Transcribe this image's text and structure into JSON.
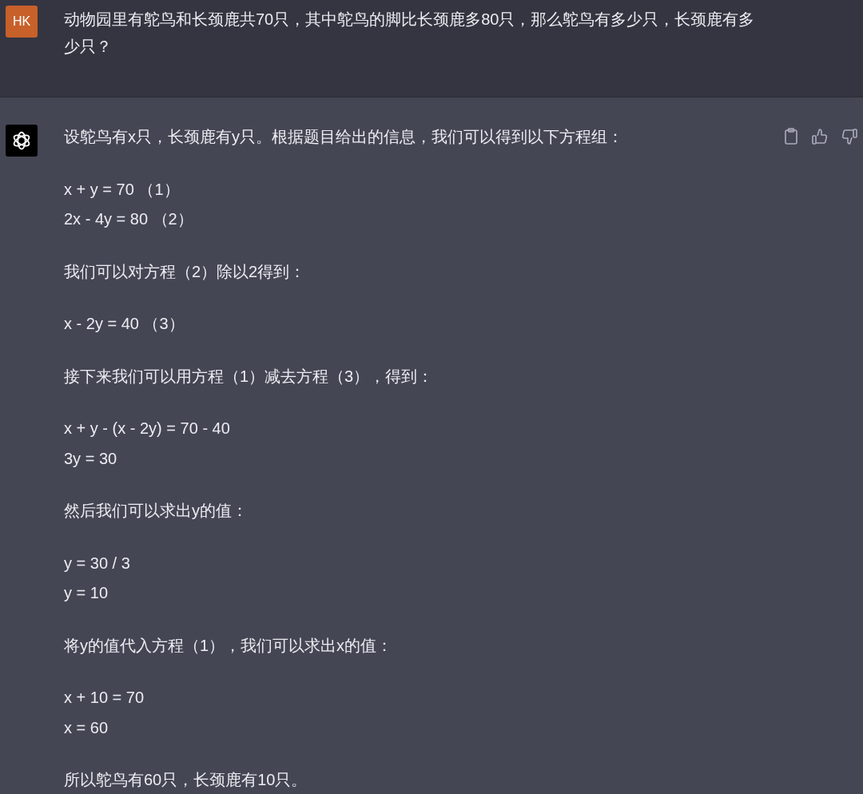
{
  "question": {
    "avatar": "HK",
    "text": "动物园里有鸵鸟和长颈鹿共70只，其中鸵鸟的脚比长颈鹿多80只，那么鸵鸟有多少只，长颈鹿有多少只？"
  },
  "answer": {
    "paragraphs": [
      {
        "lines": [
          "设鸵鸟有x只，长颈鹿有y只。根据题目给出的信息，我们可以得到以下方程组："
        ]
      },
      {
        "lines": [
          "x + y = 70 （1）",
          "2x - 4y = 80 （2）"
        ]
      },
      {
        "lines": [
          "我们可以对方程（2）除以2得到："
        ]
      },
      {
        "lines": [
          "x - 2y = 40 （3）"
        ]
      },
      {
        "lines": [
          "接下来我们可以用方程（1）减去方程（3），得到："
        ]
      },
      {
        "lines": [
          "x + y - (x - 2y) = 70 - 40",
          "3y = 30"
        ]
      },
      {
        "lines": [
          "然后我们可以求出y的值："
        ]
      },
      {
        "lines": [
          "y = 30 / 3",
          "y = 10"
        ]
      },
      {
        "lines": [
          "将y的值代入方程（1），我们可以求出x的值："
        ]
      },
      {
        "lines": [
          "x + 10 = 70",
          "x = 60"
        ]
      },
      {
        "lines": [
          "所以鸵鸟有60只，长颈鹿有10只。"
        ]
      }
    ]
  }
}
